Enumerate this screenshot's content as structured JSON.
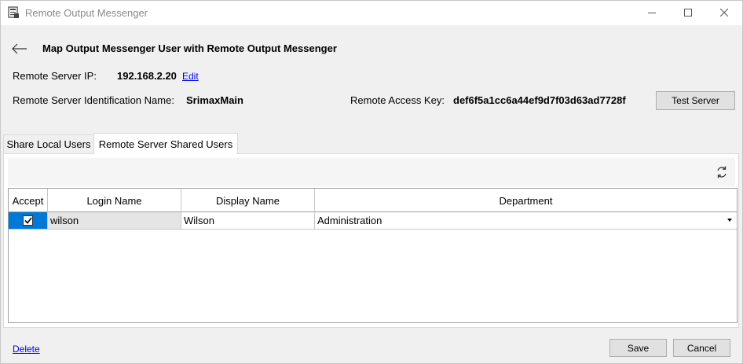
{
  "window": {
    "title": "Remote Output Messenger"
  },
  "page": {
    "title": "Map Output Messenger User with Remote Output Messenger"
  },
  "server": {
    "ip_label": "Remote Server IP:",
    "ip_value": "192.168.2.20",
    "edit_label": "Edit",
    "ident_label": "Remote Server Identification Name:",
    "ident_value": "SrimaxMain",
    "key_label": "Remote Access Key:",
    "key_value": "def6f5a1cc6a44ef9d7f03d63ad7728f",
    "test_button": "Test Server"
  },
  "tabs": [
    {
      "label": "Share Local Users",
      "active": false
    },
    {
      "label": "Remote Server Shared Users",
      "active": true
    }
  ],
  "grid": {
    "headers": [
      "Accept",
      "Login Name",
      "Display Name",
      "Department"
    ],
    "rows": [
      {
        "accepted": true,
        "login": "wilson",
        "display": "Wilson",
        "department": "Administration"
      }
    ]
  },
  "footer": {
    "delete_label": "Delete",
    "save_label": "Save",
    "cancel_label": "Cancel"
  },
  "icons": {
    "app": "app-icon",
    "back": "back-arrow-icon",
    "refresh": "refresh-icon",
    "minimize": "minimize-icon",
    "maximize": "maximize-icon",
    "close": "close-icon",
    "check": "check-icon",
    "dropdown": "dropdown-arrow-icon"
  },
  "colors": {
    "selection": "#0078d7",
    "link": "#0000ee",
    "background": "#f0f0f0"
  }
}
